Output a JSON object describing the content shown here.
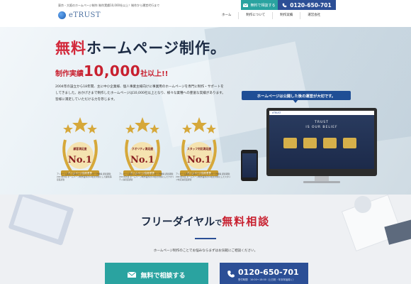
{
  "header": {
    "tagline": "東京・大阪のホームページ制作 制作実績10,000社以上！制作から運営代行まで",
    "logo_text": "eTRUST",
    "mail_button": "無料で相談する",
    "tel_button": "0120-650-701",
    "nav": [
      "ホーム",
      "制作について",
      "制作実績",
      "運営会社"
    ]
  },
  "hero": {
    "title_accent": "無料",
    "title_rest": "ホームページ制作。",
    "sub_prefix": "制作実績",
    "sub_number": "10,000",
    "sub_suffix": "社以上!!",
    "description": "2004年の設立から18年間、主に中小企業様、個人事業主様向けに事業用のホームページを専門に制作・サポートをしてきました。おかげさまで制作したホームページは10,000社以上となり、様々な業種への豊富な実績があります。皆様に満足していただける力を存じます。",
    "awards": [
      {
        "label": "顧客満足度",
        "rank": "No.1",
        "ribbon": "ホームページ制作業界"
      },
      {
        "label": "クオリティ満足度",
        "rank": "No.1",
        "ribbon": "ホームページ制作業界"
      },
      {
        "label": "スタッフ対応満足度",
        "rank": "No.1",
        "ribbon": "ホームページ制作業界"
      }
    ],
    "notes": [
      "アンケート調査：日本マーケティングリサーチ機構 調査期間：2021年6月 ホームページ制作業界の10社を対象にした顧客満足度調査",
      "アンケート調査：日本マーケティングリサーチ機構 調査期間：2021年6月 ホームページ制作業界の10社を対象にしたクオリティ満足度調査",
      "アンケート調査：日本マーケティングリサーチ機構 調査期間：2021年6月 ホームページ制作業界の10社を対象にしたスタッフ対応満足度調査"
    ],
    "bubble": "ホームページは公開した後の運営が大切です。",
    "screen_logo": "eTRUST",
    "screen_title1": "TRUST",
    "screen_title2": "IS OUR BELIEF"
  },
  "contact": {
    "title_main": "フリーダイヤル",
    "title_small": "で",
    "title_red": "無料相談",
    "description": "ホームページ制作のことでお悩みならまずはお気軽にご相談ください。",
    "mail_button": "無料で相談する",
    "tel_number": "0120-650-701",
    "tel_hours": "受付時間　10:00〜18:00（土日祝・年末年始除く）"
  },
  "colors": {
    "teal": "#2aa3a0",
    "navy": "#2c4f96",
    "red": "#c8202f",
    "gold": "#d6a83a"
  }
}
